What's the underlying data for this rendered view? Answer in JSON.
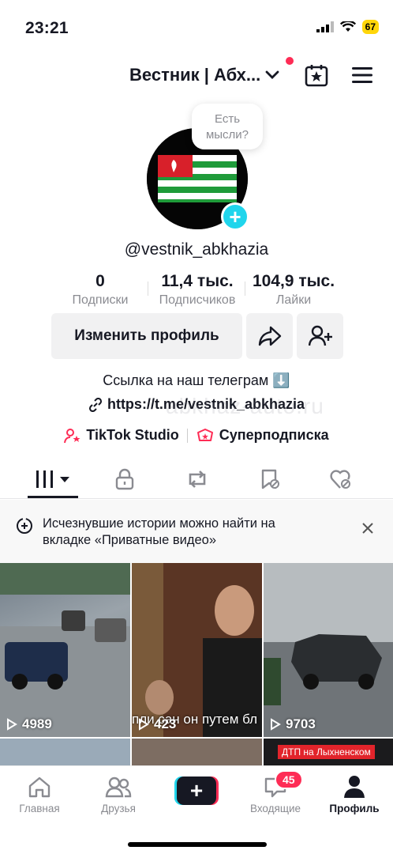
{
  "status": {
    "time": "23:21",
    "battery": "67"
  },
  "header": {
    "account_name": "Вестник | Абх..."
  },
  "bubble": {
    "text": "Есть мысли?"
  },
  "profile": {
    "username": "@vestnik_abkhazia"
  },
  "stats": [
    {
      "value": "0",
      "label": "Подписки"
    },
    {
      "value": "11,4 тыс.",
      "label": "Подписчиков"
    },
    {
      "value": "104,9 тыс.",
      "label": "Лайки"
    }
  ],
  "buttons": {
    "edit_profile": "Изменить профиль"
  },
  "bio": {
    "line": "Ссылка на наш телеграм ⬇️",
    "link": "https://t.me/vestnik_abkhazia"
  },
  "shortcuts": {
    "studio": "TikTok Studio",
    "super": "Суперподписка"
  },
  "watermark": "abkhaz-auto.ru",
  "notice": {
    "text": "Исчезнувшие истории можно найти на вкладке «Приватные видео»"
  },
  "videos": [
    {
      "views": "4989"
    },
    {
      "views": "423",
      "subtitle": "пли сан он путем бл"
    },
    {
      "views": "9703"
    }
  ],
  "next_row": {
    "tag": "ДТП на Лыхненском"
  },
  "tabbar": {
    "home": "Главная",
    "friends": "Друзья",
    "inbox": "Входящие",
    "inbox_badge": "45",
    "profile": "Профиль"
  }
}
